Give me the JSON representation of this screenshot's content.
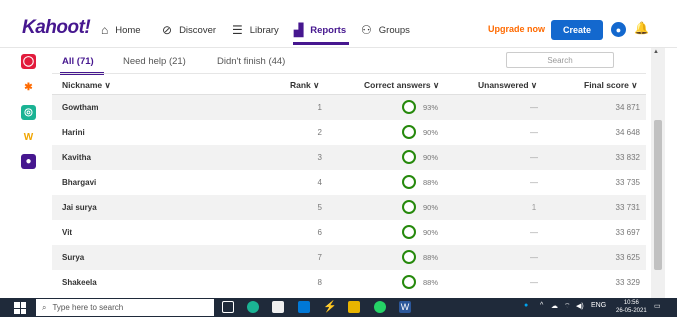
{
  "app": {
    "logo": "Kahoot!"
  },
  "nav": {
    "items": [
      {
        "label": "Home",
        "icon": "home-icon"
      },
      {
        "label": "Discover",
        "icon": "compass-icon"
      },
      {
        "label": "Library",
        "icon": "list-icon"
      },
      {
        "label": "Reports",
        "icon": "bar-chart-icon",
        "active": true
      },
      {
        "label": "Groups",
        "icon": "people-icon"
      }
    ],
    "upgrade_label": "Upgrade now",
    "create_label": "Create"
  },
  "tabs": [
    {
      "label": "All (71)",
      "active": true
    },
    {
      "label": "Need help (21)"
    },
    {
      "label": "Didn't finish (44)"
    }
  ],
  "search": {
    "placeholder": "Search"
  },
  "table": {
    "headers": {
      "nickname": "Nickname ∨",
      "rank": "Rank ∨",
      "correct": "Correct answers ∨",
      "unanswered": "Unanswered ∨",
      "score": "Final score ∨"
    },
    "rows": [
      {
        "nickname": "Gowtham",
        "rank": "1",
        "correct": "93%",
        "unanswered": "—",
        "score": "34 871"
      },
      {
        "nickname": "Harini",
        "rank": "2",
        "correct": "90%",
        "unanswered": "—",
        "score": "34 648"
      },
      {
        "nickname": "Kavitha",
        "rank": "3",
        "correct": "90%",
        "unanswered": "—",
        "score": "33 832"
      },
      {
        "nickname": "Bhargavi",
        "rank": "4",
        "correct": "88%",
        "unanswered": "—",
        "score": "33 735"
      },
      {
        "nickname": "Jai surya",
        "rank": "5",
        "correct": "90%",
        "unanswered": "1",
        "score": "33 731"
      },
      {
        "nickname": "Vit",
        "rank": "6",
        "correct": "90%",
        "unanswered": "—",
        "score": "33 697"
      },
      {
        "nickname": "Surya",
        "rank": "7",
        "correct": "88%",
        "unanswered": "—",
        "score": "33 625"
      },
      {
        "nickname": "Shakeela",
        "rank": "8",
        "correct": "88%",
        "unanswered": "—",
        "score": "33 329"
      }
    ]
  },
  "taskbar": {
    "search_placeholder": "Type here to search",
    "lang": "ENG",
    "time": "10:56",
    "date": "26-05-2021"
  },
  "colors": {
    "brand": "#46178f",
    "accent_blue": "#1368ce",
    "upgrade_orange": "#ff6a00",
    "correct_ring": "#26890c"
  }
}
